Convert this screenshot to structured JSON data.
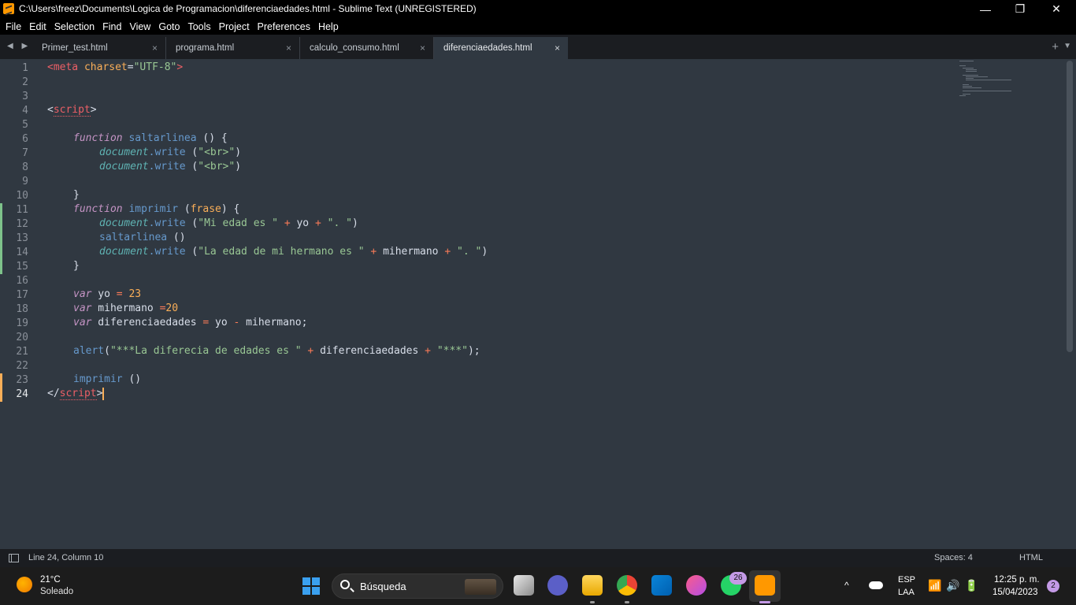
{
  "window": {
    "title": "C:\\Users\\freez\\Documents\\Logica de Programacion\\diferenciaedades.html - Sublime Text (UNREGISTERED)",
    "minimize": "—",
    "restore": "❐",
    "close": "✕"
  },
  "menu": [
    "File",
    "Edit",
    "Selection",
    "Find",
    "View",
    "Goto",
    "Tools",
    "Project",
    "Preferences",
    "Help"
  ],
  "tabs": [
    {
      "label": "Primer_test.html",
      "close": "×"
    },
    {
      "label": "programa.html",
      "close": "×"
    },
    {
      "label": "calculo_consumo.html",
      "close": "×"
    },
    {
      "label": "diferenciaedades.html",
      "close": "×",
      "active": true
    }
  ],
  "tabbar": {
    "nav": "◀ ▶",
    "plus": "+",
    "dropdown": "▼"
  },
  "editor": {
    "line_numbers": [
      "1",
      "2",
      "3",
      "4",
      "5",
      "6",
      "7",
      "8",
      "9",
      "10",
      "11",
      "12",
      "13",
      "14",
      "15",
      "16",
      "17",
      "18",
      "19",
      "20",
      "21",
      "22",
      "23",
      "24"
    ],
    "current_line": "24"
  },
  "code": {
    "l1a": "<meta ",
    "l1b": "charset",
    "l1c": "=",
    "l1d": "\"UTF-8\"",
    "l1e": ">",
    "l4a": "<",
    "l4b": "script",
    "l4c": ">",
    "l6a": "function",
    "l6b": " saltarlinea ",
    "l6c": "() {",
    "l7a": "document",
    "l7b": ".write ",
    "l7c": "(",
    "l7d": "\"<br>\"",
    "l7e": ")",
    "l8a": "document",
    "l8b": ".write ",
    "l8c": "(",
    "l8d": "\"<br>\"",
    "l8e": ")",
    "l10a": "}",
    "l11a": "function",
    "l11b": " imprimir ",
    "l11c": "(",
    "l11d": "frase",
    "l11e": ") {",
    "l12a": "document",
    "l12b": ".write ",
    "l12c": "(",
    "l12d": "\"Mi edad es \"",
    "l12e": " + ",
    "l12f": "yo",
    "l12g": " + ",
    "l12h": "\". \"",
    "l12i": ")",
    "l13a": "saltarlinea ",
    "l13b": "()",
    "l14a": "document",
    "l14b": ".write ",
    "l14c": "(",
    "l14d": "\"La edad de mi hermano es \"",
    "l14e": " + ",
    "l14f": "mihermano",
    "l14g": " + ",
    "l14h": "\". \"",
    "l14i": ")",
    "l15a": "}",
    "l17a": "var",
    "l17b": " yo ",
    "l17c": "=",
    "l17d": " 23",
    "l18a": "var",
    "l18b": " mihermano ",
    "l18c": "=",
    "l18d": "20",
    "l19a": "var",
    "l19b": " diferenciaedades ",
    "l19c": "=",
    "l19d": " yo ",
    "l19e": "-",
    "l19f": " mihermano;",
    "l21a": "alert",
    "l21b": "(",
    "l21c": "\"***La diferecia de edades es \"",
    "l21d": " + ",
    "l21e": "diferenciaedades",
    "l21f": " + ",
    "l21g": "\"***\"",
    "l21h": ");",
    "l23a": "imprimir ",
    "l23b": "()",
    "l24a": "</",
    "l24b": "script",
    "l24c": ">"
  },
  "status": {
    "position": "Line 24, Column 10",
    "spaces": "Spaces: 4",
    "syntax": "HTML"
  },
  "taskbar": {
    "temperature": "21°C",
    "weather": "Soleado",
    "search_placeholder": "Búsqueda",
    "whatsapp_badge": "26",
    "lang1": "ESP",
    "lang2": "LAA",
    "time": "12:25 p. m.",
    "date": "15/04/2023",
    "notifications": "2",
    "tray_chevron": "^",
    "sys_icons": "📶🔊🔋"
  },
  "colors": {
    "editor_bg": "#303841",
    "accent_cursor": "#f9ae58",
    "modified_green": "#7ec28a",
    "modified_orange": "#f9ae58"
  }
}
